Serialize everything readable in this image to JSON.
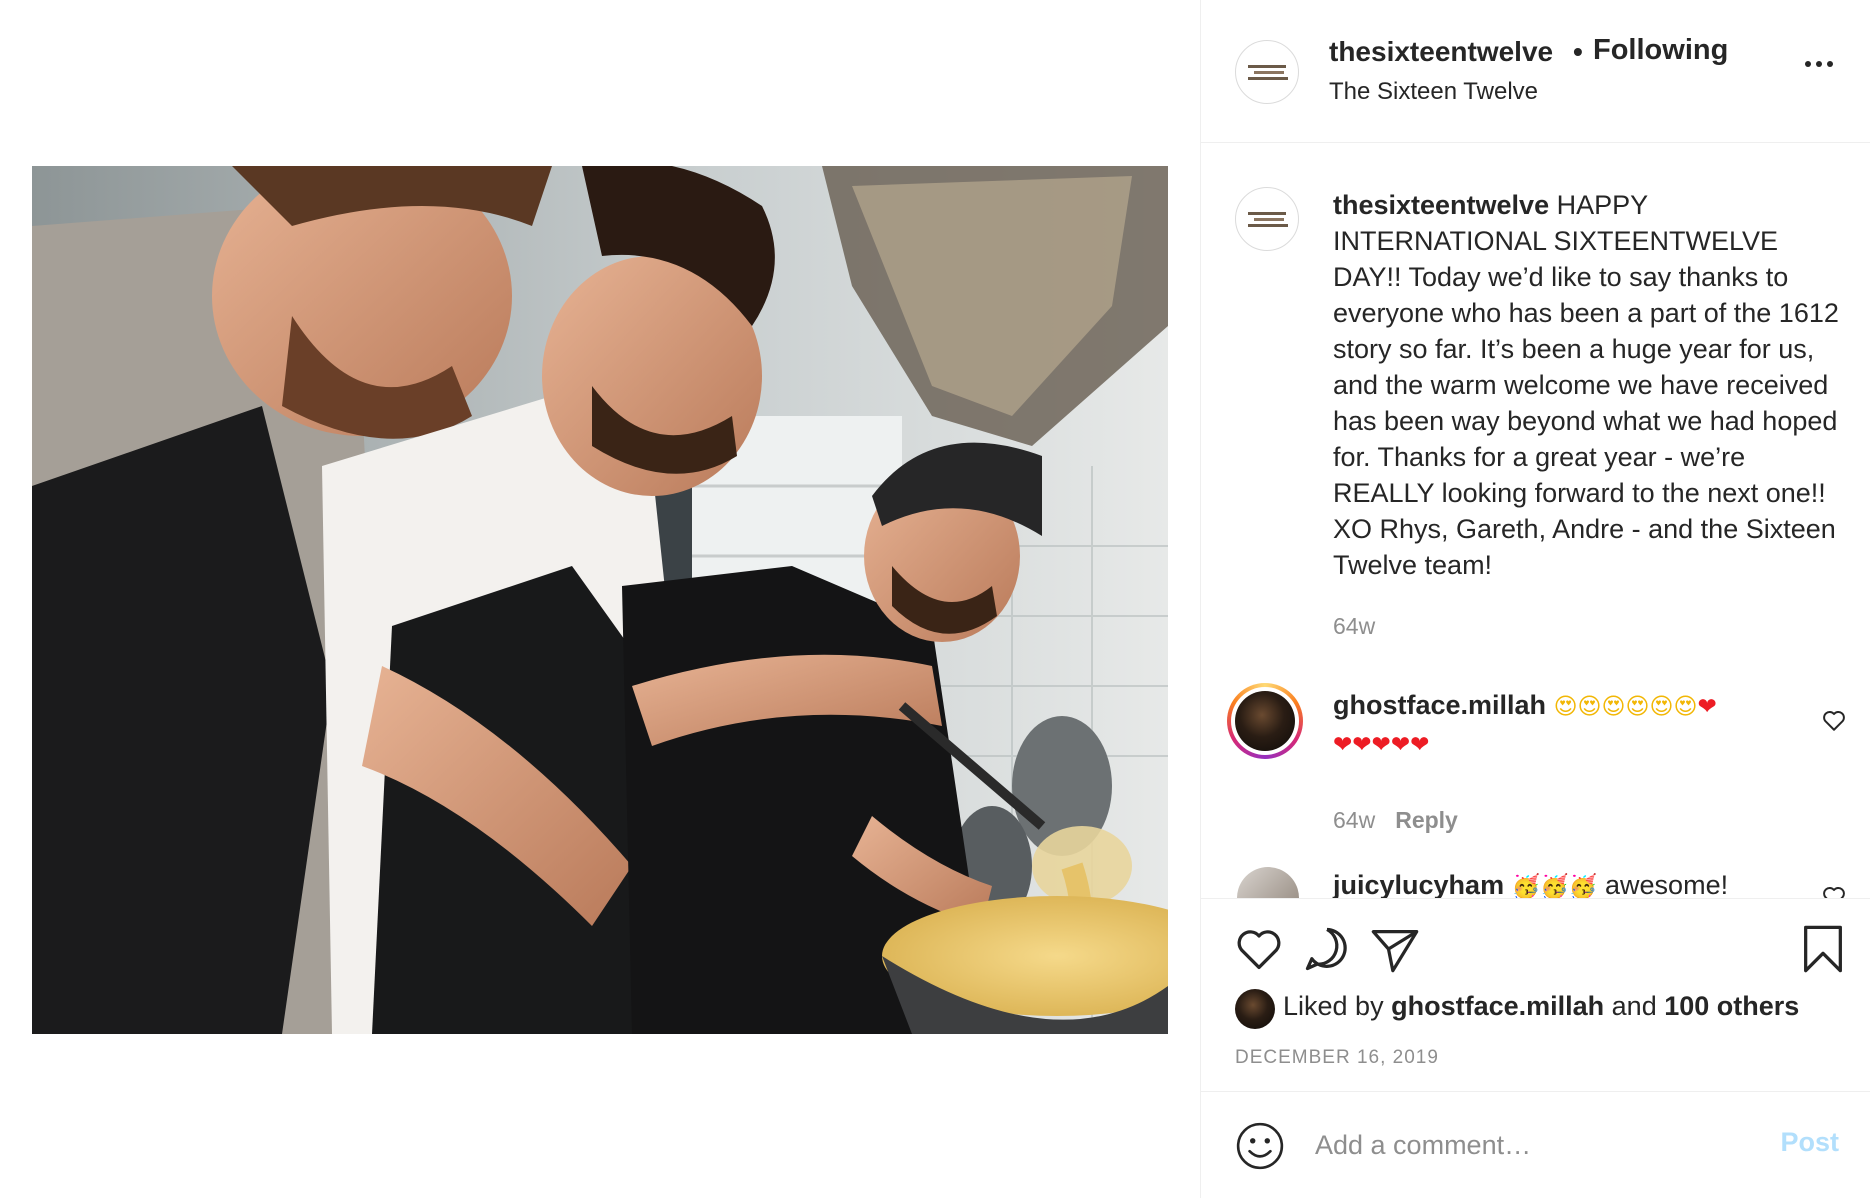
{
  "header": {
    "username": "thesixteentwelve",
    "separator": "•",
    "follow_status": "Following",
    "subtitle": "The Sixteen Twelve"
  },
  "caption": {
    "username": "thesixteentwelve",
    "text": "HAPPY INTERNATIONAL SIXTEENTWELVE DAY!! Today we’d like to say thanks to everyone who has been a part of the 1612 story so far. It’s been a huge year for us, and the warm welcome we have received has been way beyond what we had hoped for. Thanks for a great year - we’re REALLY looking forward to the next one!! XO Rhys, Gareth, Andre - and the Sixteen Twelve team!",
    "time": "64w"
  },
  "comments": [
    {
      "username": "ghostface.millah",
      "emoji_faces": "😍😍😍😍😍😍",
      "emoji_hearts_1": "❤",
      "emoji_hearts_2": "❤❤❤❤❤",
      "time": "64w",
      "reply_label": "Reply"
    },
    {
      "username": "juicylucyham",
      "emoji": "🥳🥳🥳",
      "text": "awesome!"
    }
  ],
  "likes": {
    "prefix": "Liked by",
    "user": "ghostface.millah",
    "conjunction": "and",
    "others": "100 others"
  },
  "date": "DECEMBER 16, 2019",
  "comment_box": {
    "placeholder": "Add a comment…",
    "post_label": "Post"
  },
  "icons": {
    "more": "more-options-icon",
    "like": "heart-icon",
    "comment": "comment-icon",
    "share": "share-icon",
    "save": "bookmark-icon",
    "emoji": "smile-icon"
  },
  "colors": {
    "text": "#262626",
    "muted": "#8e8e8e",
    "post_disabled": "#b2dffc",
    "border": "#efefef"
  }
}
